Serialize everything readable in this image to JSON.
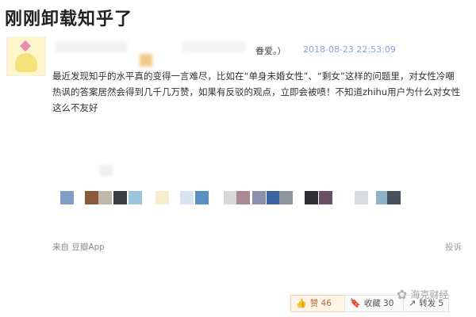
{
  "page": {
    "title": "刚刚卸载知乎了"
  },
  "post": {
    "username_suffix": "眷爱。）",
    "timestamp": "2018-08-23 22:53:09",
    "content": "最近发现知乎的水平真的变得一言难尽，比如在“单身未婚女性”、“剩女”这样的问题里，对女性冷嘲热讽的答案居然会得到几千几万赞，如果有反驳的观点，立即会被喷！不知道zhihu用户为什么对女性这么不友好",
    "source": "来自 豆瓣App",
    "report": "投诉"
  },
  "actions": {
    "like_label": "赞 46",
    "collect_label": "收藏 30",
    "share_label": "转发 5"
  },
  "icons": {
    "like": "thumb-up-icon",
    "collect": "bookmark-icon",
    "share": "share-icon",
    "watermark": "wechat-logo-icon"
  },
  "watermark": {
    "text": "海克财经"
  },
  "colors": {
    "timestamp": "#7ea8d8",
    "like_bg": "#fff4e8",
    "swatches": [
      "#7f9fc6",
      "#8a5a3a",
      "#c2b7ab",
      "#3a3d40",
      "#9ec5e0",
      "#f7eccc",
      "#d8e4ef",
      "#5a90c4",
      "#d8d8d8",
      "#a98a93",
      "#8c8fb0",
      "#3b63a3",
      "#8c95a0",
      "#2f2e33",
      "#6b4f66",
      "#d9dce0",
      "#8fb1c9",
      "#46505e"
    ]
  }
}
